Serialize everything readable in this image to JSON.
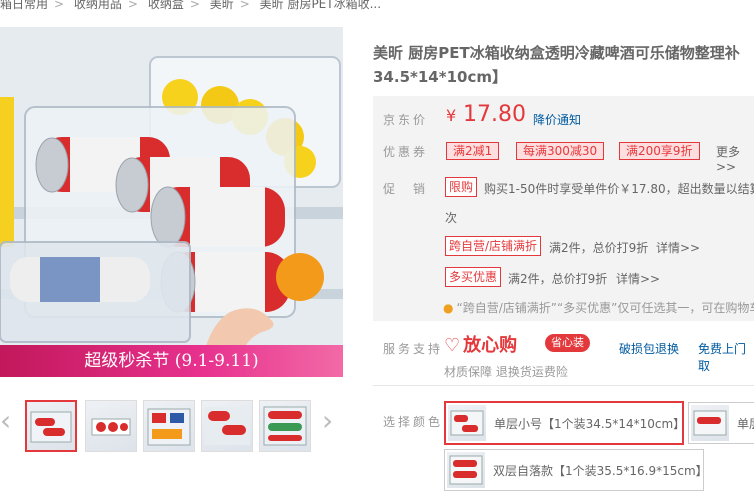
{
  "breadcrumb": [
    "箱日常用",
    "收纳用品",
    "收纳盒",
    "美昕",
    "美昕 厨房PET冰箱收..."
  ],
  "product": {
    "title_line1": "美昕 厨房PET冰箱收纳盒透明冷藏啤酒可乐储物整理补",
    "title_line2": "34.5*14*10cm】"
  },
  "gallery": {
    "promo_banner": "超级秒杀节 (9.1-9.11)",
    "prev_arrow": "‹",
    "next_arrow": "›"
  },
  "price": {
    "label": "京东价",
    "symbol": "¥",
    "value": "17.80",
    "notify": "降价通知"
  },
  "coupons": {
    "label": "优惠券",
    "items": [
      "满2减1",
      "每满300减30",
      "满200享9折"
    ],
    "more": "更多>>"
  },
  "promotion": {
    "label": "促　销",
    "limit_tag": "限购",
    "limit_text": "购买1-50件时享受单件价￥17.80，超出数量以结算",
    "limit_text_cont": "次",
    "cross_tag": "跨自营/店铺满折",
    "cross_text": "满2件，总价打9折",
    "cross_detail": "详情>>",
    "multi_tag": "多买优惠",
    "multi_text": "满2件，总价打9折",
    "multi_detail": "详情>>",
    "notice": "“跨自营/店铺满折”“多买优惠”仅可任选其一，可在购物车"
  },
  "service": {
    "label": "服务支持",
    "fangxingou": "放心购",
    "shengxin": "省心装",
    "links": [
      "破损包退换",
      "免费上门取"
    ],
    "sub": "材质保障 退换货运费险"
  },
  "color": {
    "label": "选择颜色",
    "options": [
      "单层小号【1个装34.5*14*10cm】",
      "单层",
      "双层自落款【1个装35.5*16.9*15cm】"
    ]
  },
  "colors": {
    "accent": "#e4393c",
    "link": "#005aa0"
  }
}
